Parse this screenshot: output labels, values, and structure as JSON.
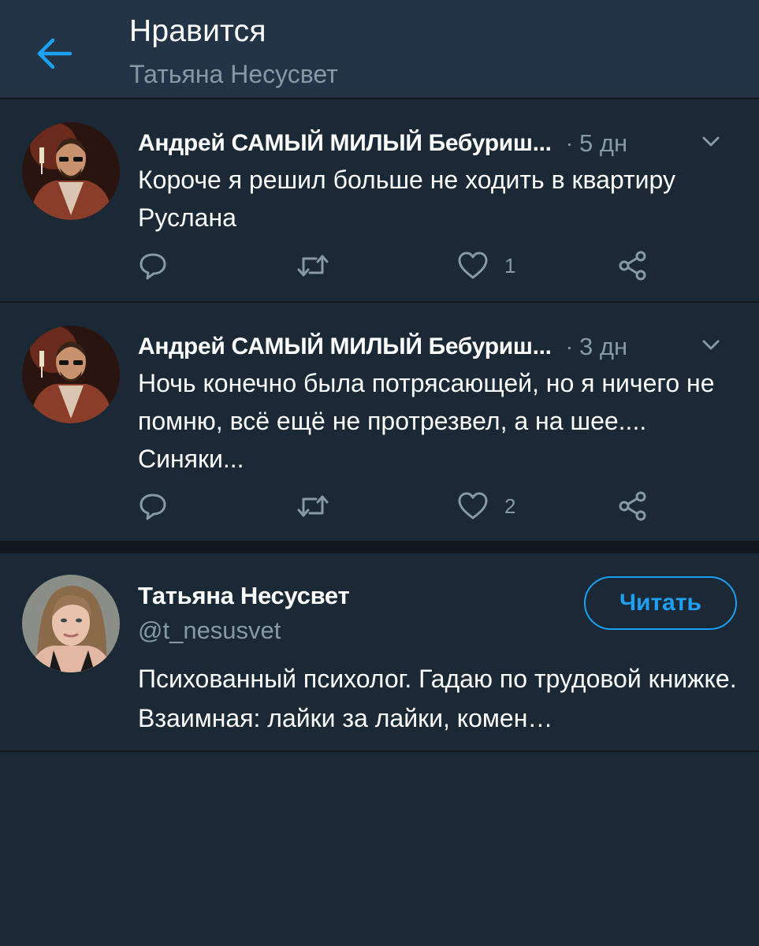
{
  "header": {
    "title": "Нравится",
    "subtitle": "Татьяна Несусвет"
  },
  "tweets": [
    {
      "author": "Андрей САМЫЙ МИЛЫЙ Бебуриш...",
      "separator": "·",
      "time": "5 дн",
      "text": "Короче я решил больше не ходить в квартиру Руслана",
      "likes": "1"
    },
    {
      "author": "Андрей САМЫЙ МИЛЫЙ Бебуриш...",
      "separator": "·",
      "time": "3 дн",
      "text": "Ночь конечно была потрясающей, но я ничего не помню, всё ещё не протрезвел, а на шее.... Синяки...",
      "likes": "2"
    }
  ],
  "user_card": {
    "name": "Татьяна Несусвет",
    "handle": "@t_nesusvet",
    "follow_label": "Читать",
    "bio": "Психованный психолог. Гадаю по трудовой книжке. Взаимная: лайки за лайки, комен…"
  },
  "icons": {
    "back": "arrow-left-icon",
    "reply": "reply-icon",
    "retweet": "retweet-icon",
    "like": "heart-icon",
    "share": "share-icon",
    "caret": "chevron-down-icon"
  },
  "colors": {
    "background": "#1b2836",
    "header": "#243447",
    "accent": "#1da1f2",
    "secondary_text": "#8899a6",
    "divider": "#10171e"
  }
}
